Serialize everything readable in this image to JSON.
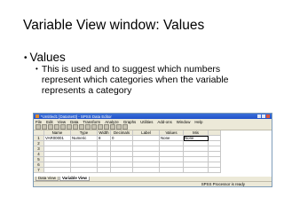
{
  "slide": {
    "title": "Variable View window: Values",
    "bullet": "Values",
    "sub_bullet": "This is used and to suggest which numbers represent which categories when the variable represents a category"
  },
  "spss": {
    "window_title": "*Untitled1 [DataSet0] - SPSS Data Editor",
    "menu": [
      "File",
      "Edit",
      "View",
      "Data",
      "Transform",
      "Analyze",
      "Graphs",
      "Utilities",
      "Add-ons",
      "Window",
      "Help"
    ],
    "columns": [
      "",
      "Name",
      "Type",
      "Width",
      "Decimals",
      "Label",
      "Values",
      "Mis"
    ],
    "rows": [
      {
        "num": "1",
        "name": "VAR00001",
        "type": "Numeric",
        "width": "8",
        "decimals": "0",
        "label": "",
        "values": "None",
        "missing": "None"
      },
      {
        "num": "2",
        "name": "",
        "type": "",
        "width": "",
        "decimals": "",
        "label": "",
        "values": "",
        "missing": ""
      },
      {
        "num": "3",
        "name": "",
        "type": "",
        "width": "",
        "decimals": "",
        "label": "",
        "values": "",
        "missing": ""
      },
      {
        "num": "4",
        "name": "",
        "type": "",
        "width": "",
        "decimals": "",
        "label": "",
        "values": "",
        "missing": ""
      },
      {
        "num": "5",
        "name": "",
        "type": "",
        "width": "",
        "decimals": "",
        "label": "",
        "values": "",
        "missing": ""
      },
      {
        "num": "6",
        "name": "",
        "type": "",
        "width": "",
        "decimals": "",
        "label": "",
        "values": "",
        "missing": ""
      },
      {
        "num": "7",
        "name": "",
        "type": "",
        "width": "",
        "decimals": "",
        "label": "",
        "values": "",
        "missing": ""
      }
    ],
    "tabs": [
      "Data View",
      "Variable View"
    ],
    "active_tab": "Variable View",
    "status": "SPSS Processor is ready",
    "title_bar_color": "#2152c9"
  }
}
